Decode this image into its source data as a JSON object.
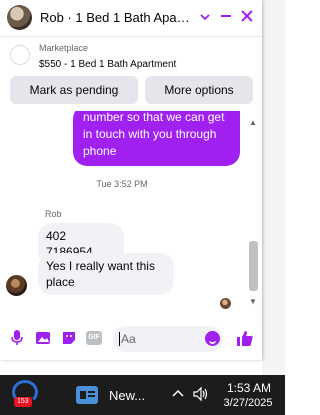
{
  "header": {
    "title": "Rob · 1 Bed 1 Bath Apartm...",
    "icons": [
      "chevron-down-icon",
      "minimize-icon",
      "close-icon"
    ]
  },
  "marketplace": {
    "label": "Marketplace",
    "listing": "$550 - 1 Bed 1 Bath Apartment",
    "mark_pending_label": "Mark as pending",
    "more_options_label": "More options"
  },
  "messages": {
    "outgoing_text": "number so that we can get in touch with you through phone",
    "timestamp": "Tue 3:52 PM",
    "sender": "Rob",
    "incoming": [
      "402 7186954",
      "Yes I really want this place"
    ]
  },
  "composer": {
    "placeholder": "Aa",
    "icons": [
      "microphone-icon",
      "image-icon",
      "sticker-icon",
      "gif-icon",
      "emoji-icon",
      "like-icon"
    ]
  },
  "taskbar": {
    "badge_count": "153",
    "news_label": "New...",
    "time": "1:53 AM",
    "date": "3/27/2025"
  },
  "colors": {
    "accent": "#a020f0",
    "taskbar_bg": "#1c1c1c"
  }
}
